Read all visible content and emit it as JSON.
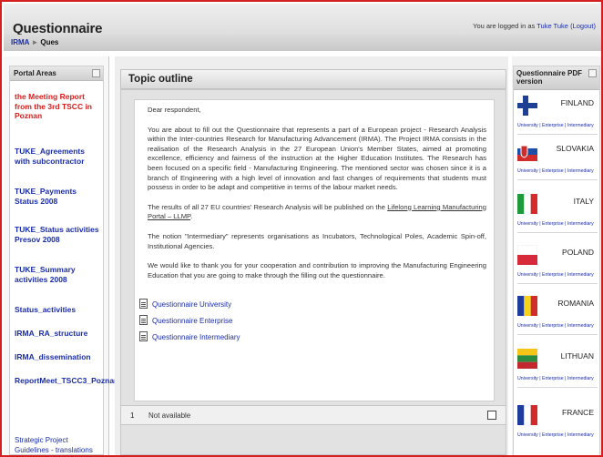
{
  "header": {
    "title": "Questionnaire",
    "login_prefix": "You are logged in as",
    "user_link": "Tuke Tuke",
    "logout_link": "(Logout)"
  },
  "breadcrumb": {
    "root": "IRMA",
    "separator": "►",
    "current": "Ques"
  },
  "left": {
    "heading": "Portal Areas",
    "items": [
      "the Meeting Report from the 3rd TSCC in Poznan",
      "TUKE_Agreements with subcontractor",
      "TUKE_Payments Status 2008",
      "TUKE_Status activities Presov 2008",
      "TUKE_Summary activities 2008",
      "Status_activities",
      "IRMA_RA_structure",
      "IRMA_dissemination",
      "ReportMeet_TSCC3_Poznan",
      "Strategic Project Guidelines - translations"
    ]
  },
  "main": {
    "topic_heading": "Topic outline",
    "greeting": "Dear respondent,",
    "para1": "You are about to fill out the Questionnaire that represents a part of a European project - Research Analysis within the Inter-countries Research for Manufacturing Advancement (IRMA). The Project IRMA consists in the realisation of the Research Analysis in the 27 European Union's Member States, aimed at promoting excellence, efficiency and fairness of the instruction at the Higher Education Institutes. The Research has been focused on a specific field - Manufacturing Engineering. The mentioned sector was chosen since it is a branch of Engineering with a high level of innovation and fast changes of requirements that students must possess in order to be adapt and competitive in terms of the labour market needs.",
    "para2_prefix": "The results of all 27 EU countries' Research Analysis will be published on the ",
    "para2_link": "Lifelong Learning Manufacturing Portal – LLMP",
    "para2_suffix": ".",
    "para3": "The notion \"Intermediary\" represents organisations as Incubators, Technological Poles, Academic Spin-off, Institutional Agencies.",
    "para4": "We would like to thank you for your cooperation and contribution to improving the Manufacturing Engineering Education that you are going to make through the filling out the questionnaire.",
    "questionnaires": [
      "Questionnaire University",
      "Questionnaire Enterprise",
      "Questionnaire Intermediary"
    ],
    "section1_number": "1",
    "section1_text": "Not available"
  },
  "right": {
    "heading": "Questionnaire PDF version",
    "link_text": "University | Enterprise | Intermediary",
    "countries": [
      "FINLAND",
      "SLOVAKIA",
      "ITALY",
      "POLAND",
      "ROMANIA",
      "LITHUAN",
      "FRANCE"
    ]
  },
  "colors": {
    "frame_border": "#d42020",
    "link_blue": "#1a2da6",
    "portal_red": "#d81b1b"
  }
}
